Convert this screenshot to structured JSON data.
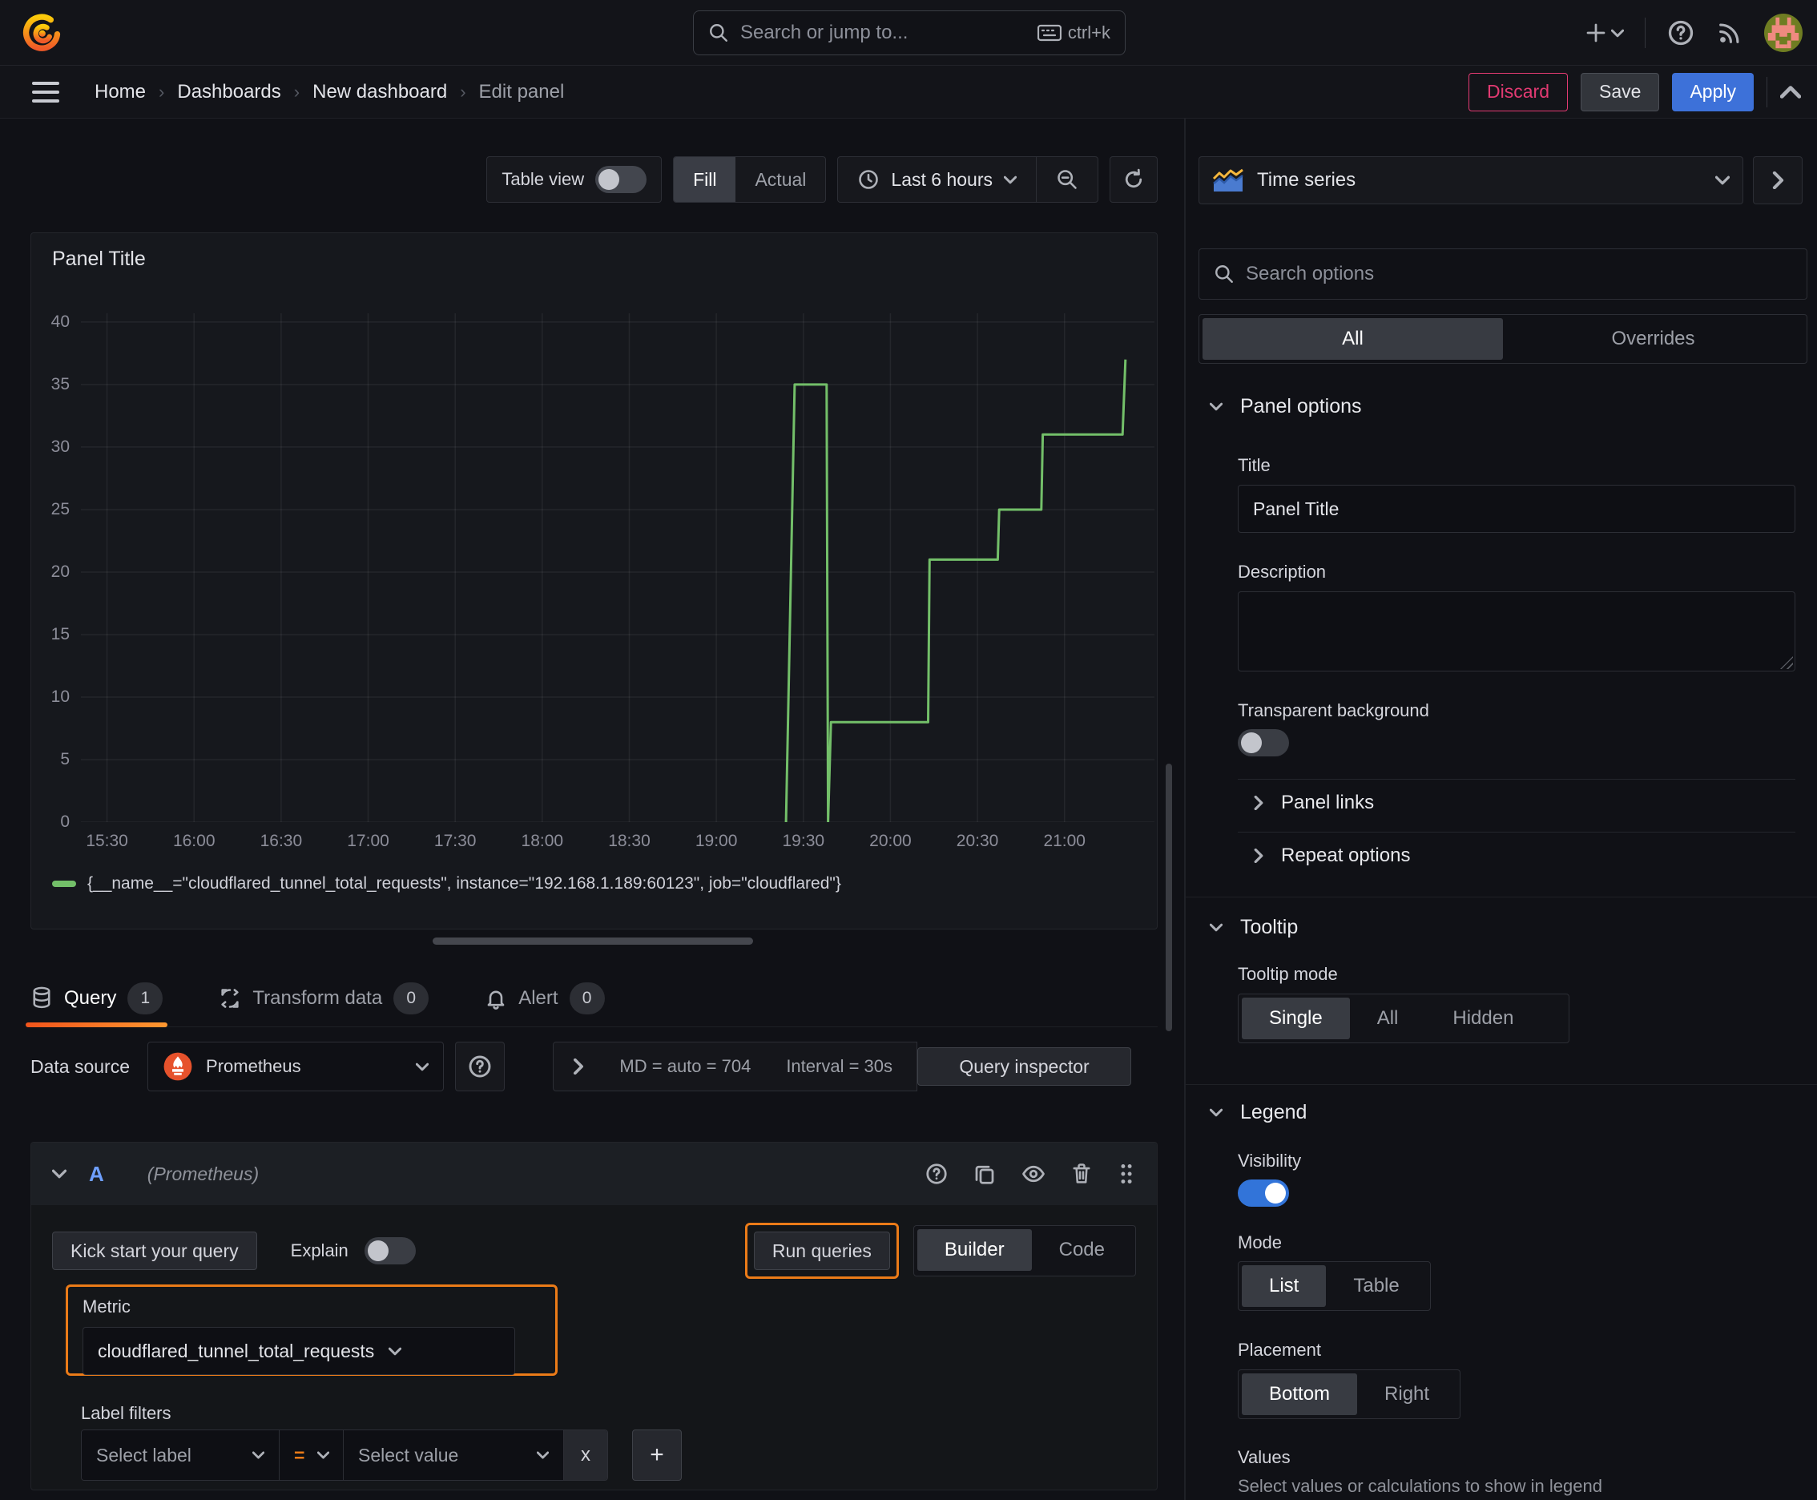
{
  "topnav": {
    "search_placeholder": "Search or jump to...",
    "search_shortcut": "ctrl+k"
  },
  "breadcrumb": {
    "items": [
      "Home",
      "Dashboards",
      "New dashboard",
      "Edit panel"
    ],
    "discard": "Discard",
    "save": "Save",
    "apply": "Apply"
  },
  "panel_toolbar": {
    "table_view": "Table view",
    "fill": "Fill",
    "actual": "Actual",
    "time_range": "Last 6 hours"
  },
  "panel": {
    "title": "Panel Title"
  },
  "chart_data": {
    "type": "line",
    "title": "Panel Title",
    "x_domain_min": [
      -9,
      361
    ],
    "y_domain": [
      0,
      40.7
    ],
    "grid": true,
    "legend_position": "bottom",
    "x_ticks": [
      {
        "label": "15:30",
        "min": 0
      },
      {
        "label": "16:00",
        "min": 30
      },
      {
        "label": "16:30",
        "min": 60
      },
      {
        "label": "17:00",
        "min": 90
      },
      {
        "label": "17:30",
        "min": 120
      },
      {
        "label": "18:00",
        "min": 150
      },
      {
        "label": "18:30",
        "min": 180
      },
      {
        "label": "19:00",
        "min": 210
      },
      {
        "label": "19:30",
        "min": 240
      },
      {
        "label": "20:00",
        "min": 270
      },
      {
        "label": "20:30",
        "min": 300
      },
      {
        "label": "21:00",
        "min": 330
      }
    ],
    "y_ticks": [
      0,
      5,
      10,
      15,
      20,
      25,
      30,
      35,
      40
    ],
    "series": [
      {
        "name": "{__name__=\"cloudflared_tunnel_total_requests\", instance=\"192.168.1.189:60123\", job=\"cloudflared\"}",
        "color": "#73bf69",
        "points_min_val": [
          [
            234,
            0
          ],
          [
            237,
            35
          ],
          [
            248,
            35
          ],
          [
            248.5,
            0
          ],
          [
            249.5,
            8
          ],
          [
            283,
            8
          ],
          [
            283.5,
            21
          ],
          [
            307,
            21
          ],
          [
            307.5,
            25
          ],
          [
            322,
            25
          ],
          [
            322.5,
            31
          ],
          [
            350,
            31
          ],
          [
            351,
            37
          ]
        ]
      }
    ]
  },
  "tabs": {
    "query": "Query",
    "query_count": "1",
    "transform": "Transform data",
    "transform_count": "0",
    "alert": "Alert",
    "alert_count": "0"
  },
  "datasource_row": {
    "label": "Data source",
    "name": "Prometheus",
    "stats_md": "MD = auto = 704",
    "stats_interval": "Interval = 30s",
    "query_inspector": "Query inspector"
  },
  "query_editor": {
    "ref_id": "A",
    "ds_hint": "(Prometheus)",
    "kick_start": "Kick start your query",
    "explain": "Explain",
    "run_queries": "Run queries",
    "builder": "Builder",
    "code": "Code",
    "metric_label": "Metric",
    "metric_value": "cloudflared_tunnel_total_requests",
    "label_filters": "Label filters",
    "select_label": "Select label",
    "operator": "=",
    "select_value": "Select value",
    "remove": "x",
    "add": "+"
  },
  "sidebar": {
    "viz_type": "Time series",
    "search_placeholder": "Search options",
    "tab_all": "All",
    "tab_overrides": "Overrides",
    "panel_options": {
      "header": "Panel options",
      "title_label": "Title",
      "title_value": "Panel Title",
      "description_label": "Description",
      "transparent_label": "Transparent background"
    },
    "collapsed": {
      "panel_links": "Panel links",
      "repeat_options": "Repeat options"
    },
    "tooltip": {
      "header": "Tooltip",
      "mode_label": "Tooltip mode",
      "options": [
        "Single",
        "All",
        "Hidden"
      ]
    },
    "legend": {
      "header": "Legend",
      "visibility_label": "Visibility",
      "mode_label": "Mode",
      "mode_options": [
        "List",
        "Table"
      ],
      "placement_label": "Placement",
      "placement_options": [
        "Bottom",
        "Right"
      ],
      "values_label": "Values",
      "values_help": "Select values or calculations to show in legend"
    }
  },
  "colors": {
    "series_green": "#73bf69",
    "highlight_orange": "#eb7b18",
    "apply_blue": "#3d71d9",
    "discard_pink": "#e23a72"
  }
}
